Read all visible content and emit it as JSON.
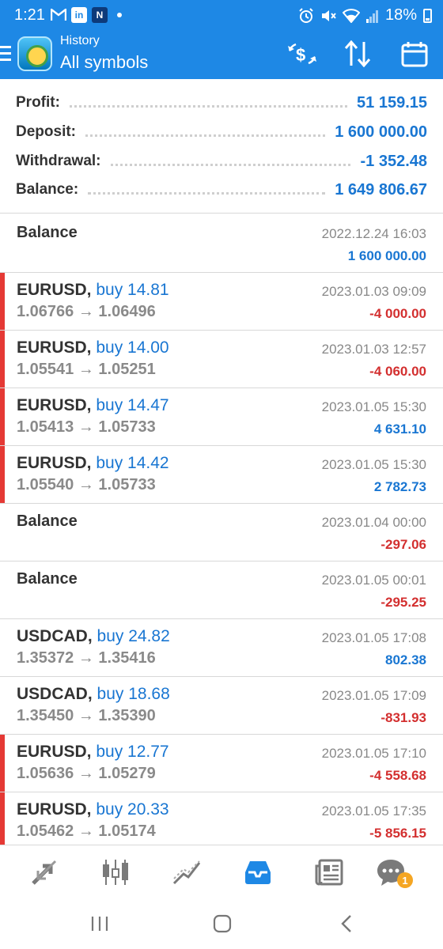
{
  "status_bar": {
    "time": "1:21",
    "left_icons": [
      "gmail-icon",
      "linkedin-icon",
      "app-n-icon"
    ],
    "right_icons": [
      "alarm-icon",
      "mute-icon",
      "wifi-icon",
      "signal-icon"
    ],
    "battery": "18%"
  },
  "app_bar": {
    "subtitle": "History",
    "title": "All symbols",
    "actions": [
      "currency-exchange-icon",
      "sort-icon",
      "calendar-icon"
    ]
  },
  "summary": [
    {
      "label": "Profit:",
      "value": "51 159.15"
    },
    {
      "label": "Deposit:",
      "value": "1 600 000.00"
    },
    {
      "label": "Withdrawal:",
      "value": "-1 352.48"
    },
    {
      "label": "Balance:",
      "value": "1 649 806.67"
    }
  ],
  "items": [
    {
      "kind": "balance",
      "title": "Balance",
      "date": "2022.12.24 16:03",
      "profit": "1 600 000.00",
      "positive": true
    },
    {
      "kind": "trade",
      "symbol": "EURUSD,",
      "side": "buy 14.81",
      "prices": "1.06766 → 1.06496",
      "date": "2023.01.03 09:09",
      "profit": "-4 000.00",
      "positive": false
    },
    {
      "kind": "trade",
      "symbol": "EURUSD,",
      "side": "buy 14.00",
      "prices": "1.05541 → 1.05251",
      "date": "2023.01.03 12:57",
      "profit": "-4 060.00",
      "positive": false
    },
    {
      "kind": "trade",
      "symbol": "EURUSD,",
      "side": "buy 14.47",
      "prices": "1.05413 → 1.05733",
      "date": "2023.01.05 15:30",
      "profit": "4 631.10",
      "positive": true
    },
    {
      "kind": "trade",
      "symbol": "EURUSD,",
      "side": "buy 14.42",
      "prices": "1.05540 → 1.05733",
      "date": "2023.01.05 15:30",
      "profit": "2 782.73",
      "positive": true
    },
    {
      "kind": "balance",
      "title": "Balance",
      "date": "2023.01.04 00:00",
      "profit": "-297.06",
      "positive": false
    },
    {
      "kind": "balance",
      "title": "Balance",
      "date": "2023.01.05 00:01",
      "profit": "-295.25",
      "positive": false
    },
    {
      "kind": "trade",
      "symbol": "USDCAD,",
      "side": "buy 24.82",
      "prices": "1.35372 → 1.35416",
      "date": "2023.01.05 17:08",
      "profit": "802.38",
      "positive": true
    },
    {
      "kind": "trade",
      "symbol": "USDCAD,",
      "side": "buy 18.68",
      "prices": "1.35450 → 1.35390",
      "date": "2023.01.05 17:09",
      "profit": "-831.93",
      "positive": false
    },
    {
      "kind": "trade",
      "symbol": "EURUSD,",
      "side": "buy 12.77",
      "prices": "1.05636 → 1.05279",
      "date": "2023.01.05 17:10",
      "profit": "-4 558.68",
      "positive": false
    },
    {
      "kind": "trade",
      "symbol": "EURUSD,",
      "side": "buy 20.33",
      "prices": "1.05462 → 1.05174",
      "date": "2023.01.05 17:35",
      "profit": "-5 856.15",
      "positive": false
    }
  ],
  "bottom_nav": {
    "tabs": [
      "quotes-icon",
      "chart-icon",
      "trade-icon",
      "history-icon",
      "news-icon",
      "chat-icon"
    ],
    "active": "history-icon",
    "chat_badge": "1"
  },
  "colors": {
    "accent": "#1e88e5",
    "value_blue": "#1976d2",
    "loss_red": "#d32f2f",
    "loss_bar": "#e53935"
  }
}
